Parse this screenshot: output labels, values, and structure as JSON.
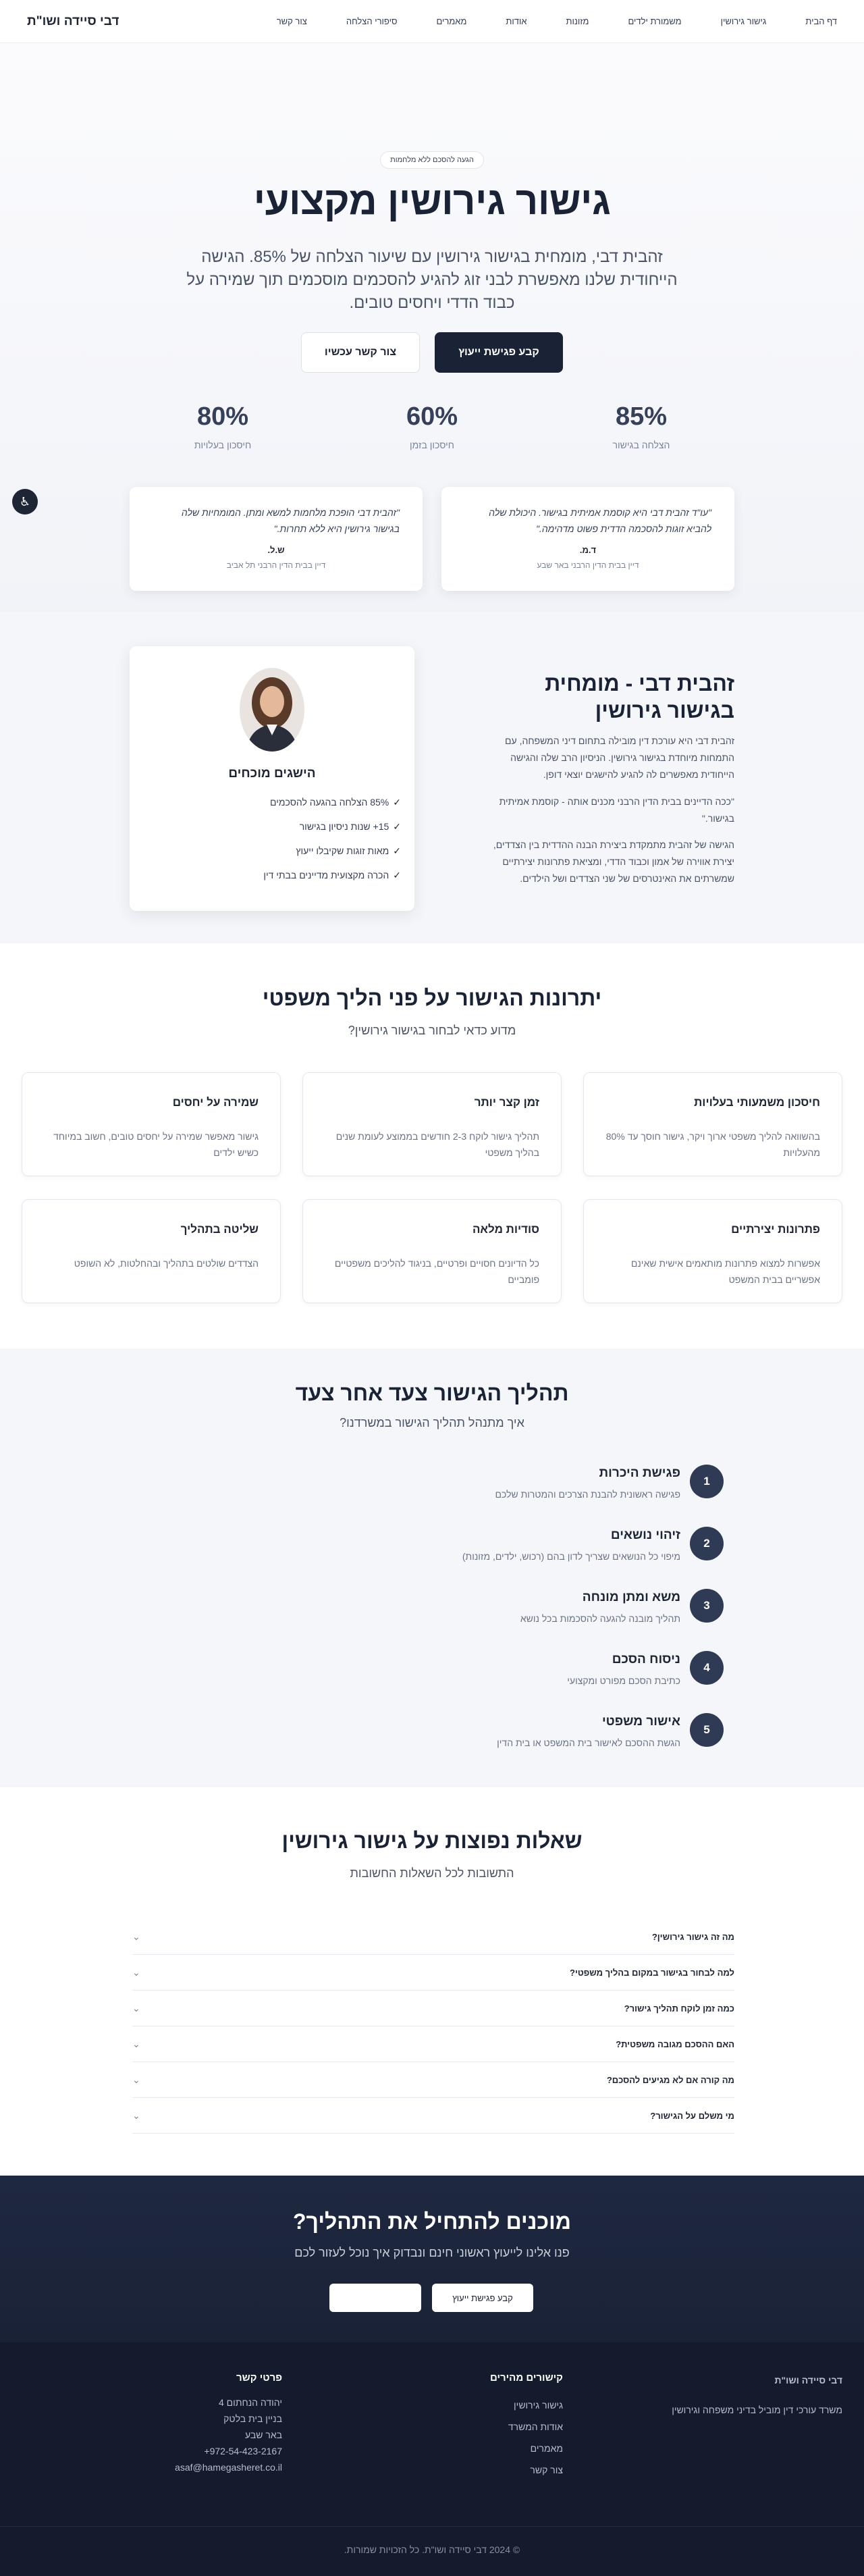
{
  "nav": {
    "brand": "דבי סיידה ושו\"ת",
    "links": [
      "דף הבית",
      "גישור גירושין",
      "משמורת ילדים",
      "מזונות",
      "אודות",
      "מאמרים",
      "סיפורי הצלחה",
      "צור קשר"
    ]
  },
  "hero": {
    "badge": "הגעה להסכם ללא מלחמות",
    "title": "גישור גירושין מקצועי",
    "text": "זהבית דבי, מומחית בגישור גירושין עם שיעור הצלחה של 85%. הגישה הייחודית שלנו מאפשרת לבני זוג להגיע להסכמים מוסכמים תוך שמירה על כבוד הדדי ויחסים טובים.",
    "btn_primary": "קבע פגישת ייעוץ",
    "btn_secondary": "צור קשר עכשיו",
    "stats": [
      {
        "num": "85%",
        "label": "הצלחה בגישור"
      },
      {
        "num": "60%",
        "label": "חיסכון בזמן"
      },
      {
        "num": "80%",
        "label": "חיסכון בעלויות"
      }
    ],
    "testimonials": [
      {
        "quote": "\"עו\"ד זהבית דבי היא קוסמת אמיתית בגישור. היכולת שלה להביא זוגות להסכמה הדדית פשוט מדהימה.\"",
        "who": "ד.מ.",
        "role": "דיין בבית הדין הרבני באר שבע"
      },
      {
        "quote": "\"זהבית דבי הופכת מלחמות למשא ומתן. המומחיות שלה בגישור גירושין היא ללא תחרות.\"",
        "who": "ש.ל.",
        "role": "דיין בבית הדין הרבני תל אביב"
      }
    ],
    "access_icon": "♿"
  },
  "about": {
    "card_title": "הישגים מוכחים",
    "achievements": [
      "85% הצלחה בהגעה להסכמים",
      "15+ שנות ניסיון בגישור",
      "מאות זוגות שקיבלו ייעוץ",
      "הכרה מקצועית מדיינים בבתי דין"
    ],
    "check": "✓",
    "title": "זהבית דבי - מומחית בגישור גירושין",
    "p1": "זהבית דבי היא עורכת דין מובילה בתחום דיני המשפחה, עם התמחות מיוחדת בגישור גירושין. הניסיון הרב שלה והגישה הייחודית מאפשרים לה להגיע להישגים יוצאי דופן.",
    "p2": "\"ככה הדיינים בבית הדין הרבני מכנים אותה - קוסמת אמיתית בגישור.\"",
    "p3": "הגישה של זהבית מתמקדת ביצירת הבנה ההדדית בין הצדדים, יצירת אווירה של אמון וכבוד הדדי, ומציאת פתרונות יצירתיים שמשרתים את האינטרסים של שני הצדדים ושל הילדים."
  },
  "advantages": {
    "title": "יתרונות הגישור על פני הליך משפטי",
    "subtitle": "מדוע כדאי לבחור בגישור גירושין?",
    "cards": [
      {
        "title": "חיסכון משמעותי בעלויות",
        "text": "בהשוואה להליך משפטי ארוך ויקר, גישור חוסך עד 80% מהעלויות"
      },
      {
        "title": "זמן קצר יותר",
        "text": "תהליך גישור לוקח 2-3 חודשים בממוצע לעומת שנים בהליך משפטי"
      },
      {
        "title": "שמירה על יחסים",
        "text": "גישור מאפשר שמירה על יחסים טובים, חשוב במיוחד כשיש ילדים"
      },
      {
        "title": "פתרונות יצירתיים",
        "text": "אפשרות למצוא פתרונות מותאמים אישית שאינם אפשריים בבית המשפט"
      },
      {
        "title": "סודיות מלאה",
        "text": "כל הדיונים חסויים ופרטיים, בניגוד להליכים משפטיים פומביים"
      },
      {
        "title": "שליטה בתהליך",
        "text": "הצדדים שולטים בתהליך ובהחלטות, לא השופט"
      }
    ]
  },
  "process": {
    "title": "תהליך הגישור צעד אחר צעד",
    "subtitle": "איך מתנהל תהליך הגישור במשרדנו?",
    "steps": [
      {
        "n": "1",
        "title": "פגישת היכרות",
        "text": "פגישה ראשונית להבנת הצרכים והמטרות שלכם"
      },
      {
        "n": "2",
        "title": "זיהוי נושאים",
        "text": "מיפוי כל הנושאים שצריך לדון בהם (רכוש, ילדים, מזונות)"
      },
      {
        "n": "3",
        "title": "משא ומתן מונחה",
        "text": "תהליך מובנה להגעה להסכמות בכל נושא"
      },
      {
        "n": "4",
        "title": "ניסוח הסכם",
        "text": "כתיבת הסכם מפורט ומקצועי"
      },
      {
        "n": "5",
        "title": "אישור משפטי",
        "text": "הגשת ההסכם לאישור בית המשפט או בית הדין"
      }
    ]
  },
  "faq": {
    "title": "שאלות נפוצות על גישור גירושין",
    "subtitle": "התשובות לכל השאלות החשובות",
    "items": [
      "מה זה גישור גירושין?",
      "למה לבחור בגישור במקום בהליך משפטי?",
      "כמה זמן לוקח תהליך גישור?",
      "האם ההסכם מגובה משפטית?",
      "מה קורה אם לא מגיעים להסכם?",
      "מי משלם על הגישור?"
    ],
    "chevron": "⌄"
  },
  "cta": {
    "title": "מוכנים להתחיל את התהליך?",
    "text": "פנו אלינו לייעוץ ראשוני חינם ונבדוק איך נוכל לעזור לכם",
    "btn": "קבע פגישת ייעוץ"
  },
  "footer": {
    "brand": "דבי סיידה ושו\"ת",
    "tagline": "משרד עורכי דין מוביל בדיני משפחה וגירושין",
    "links_title": "קישורים מהירים",
    "links": [
      "גישור גירושין",
      "אודות המשרד",
      "מאמרים",
      "צור קשר"
    ],
    "contact_title": "פרטי קשר",
    "contact": [
      "יהודה הנחתום 4",
      "בניין בית בלטק",
      "באר שבע",
      "+972-54-423-2167",
      "asaf@hamegasheret.co.il"
    ],
    "copyright": "© 2024 דבי סיידה ושו\"ת. כל הזכויות שמורות."
  }
}
